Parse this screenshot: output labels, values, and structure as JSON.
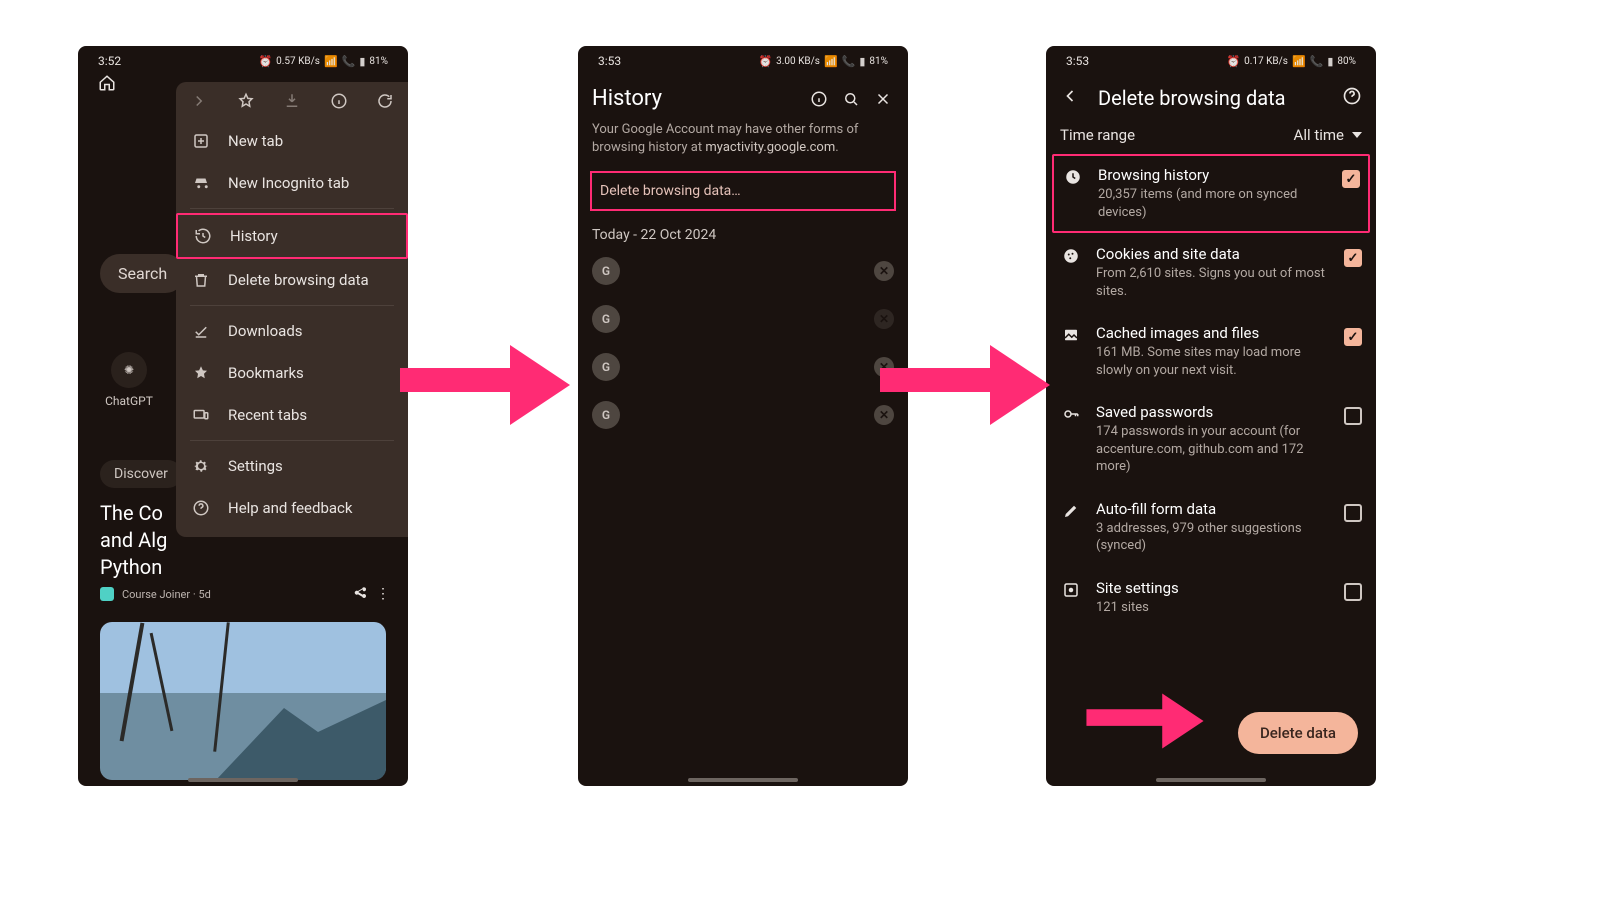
{
  "phone1": {
    "status": {
      "time": "3:52",
      "battery": "81%",
      "net": "0.57 KB/s"
    },
    "background": {
      "search_chip": "Search",
      "chatgpt_label": "ChatGPT",
      "discover_label": "Discover",
      "headline_line1": "The Co",
      "headline_line2": "and Alg",
      "headline_line3": "Python",
      "feed_source": "Course Joiner · 5d"
    },
    "menu": {
      "items": {
        "new_tab": "New tab",
        "incognito": "New Incognito tab",
        "history": "History",
        "delete_data": "Delete browsing data",
        "downloads": "Downloads",
        "bookmarks": "Bookmarks",
        "recent": "Recent tabs",
        "settings": "Settings",
        "help": "Help and feedback"
      }
    }
  },
  "phone2": {
    "status": {
      "time": "3:53",
      "battery": "81%",
      "net": "3.00 KB/s"
    },
    "title": "History",
    "notice_a": "Your Google Account may have other forms of browsing history at ",
    "notice_link": "myactivity.google.com",
    "notice_b": ".",
    "delete_link": "Delete browsing data…",
    "date_label": "Today - 22 Oct 2024",
    "entries": [
      {
        "favicon": "G"
      },
      {
        "favicon": "G"
      },
      {
        "favicon": "G"
      },
      {
        "favicon": "G"
      }
    ]
  },
  "phone3": {
    "status": {
      "time": "3:53",
      "battery": "80%",
      "net": "0.17 KB/s"
    },
    "title": "Delete browsing data",
    "time_range_label": "Time range",
    "time_range_value": "All time",
    "options": {
      "history": {
        "title": "Browsing history",
        "sub": "20,357 items (and more on synced devices)",
        "checked": true
      },
      "cookies": {
        "title": "Cookies and site data",
        "sub": "From 2,610 sites. Signs you out of most sites.",
        "checked": true
      },
      "cache": {
        "title": "Cached images and files",
        "sub": "161 MB. Some sites may load more slowly on your next visit.",
        "checked": true
      },
      "passwords": {
        "title": "Saved passwords",
        "sub": "174 passwords in your account (for accenture.com, github.com and 172 more)",
        "checked": false
      },
      "autofill": {
        "title": "Auto-fill form data",
        "sub": "3 addresses, 979 other suggestions (synced)",
        "checked": false
      },
      "site": {
        "title": "Site settings",
        "sub": "121 sites",
        "checked": false
      }
    },
    "delete_button": "Delete data"
  }
}
